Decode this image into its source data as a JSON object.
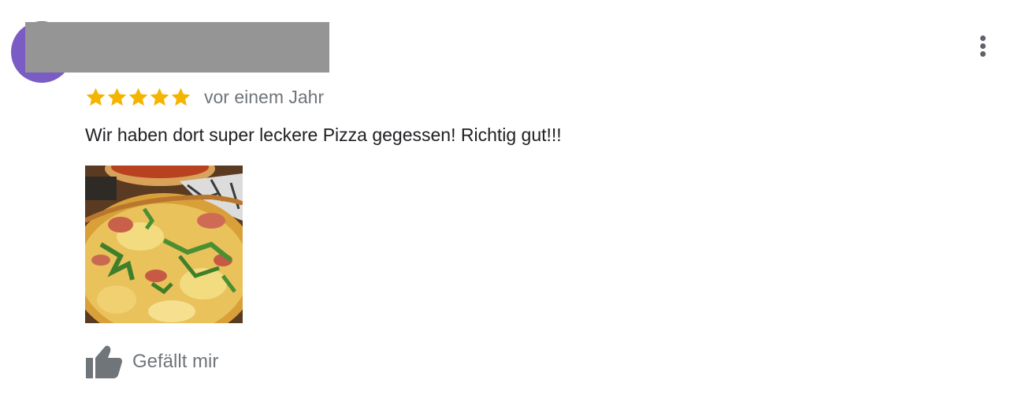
{
  "review": {
    "rating": 5,
    "rating_max": 5,
    "time": "vor einem Jahr",
    "text": "Wir haben dort super leckere Pizza gegessen! Richtig gut!!!",
    "like_label": "Gefällt mir",
    "star_color": "#f4b400",
    "avatar_color": "#7b5cc4",
    "redaction_color": "#959595"
  },
  "icons": {
    "more": "more-vertical-icon",
    "like": "thumbs-up-icon",
    "star": "star-icon"
  }
}
